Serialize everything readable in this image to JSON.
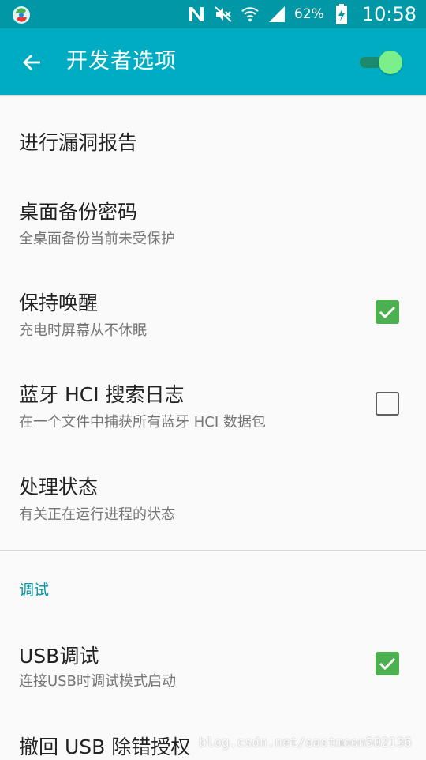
{
  "status_bar": {
    "battery_percent": "62%",
    "time": "10:58",
    "icons": [
      "app-notification-icon",
      "nfc-icon",
      "mute-icon",
      "wifi-icon",
      "cell-signal-icon",
      "battery-charging-icon"
    ]
  },
  "app_bar": {
    "title": "开发者选项",
    "master_switch_on": true,
    "accent_color": "#00acc1"
  },
  "items": [
    {
      "title": "进行漏洞报告",
      "summary": ""
    },
    {
      "title": "桌面备份密码",
      "summary": "全桌面备份当前未受保护"
    },
    {
      "title": "保持唤醒",
      "summary": "充电时屏幕从不休眠",
      "checked": true
    },
    {
      "title": "蓝牙 HCI 搜索日志",
      "summary": "在一个文件中捕获所有蓝牙 HCI 数据包",
      "checked": false
    },
    {
      "title": "处理状态",
      "summary": "有关正在运行进程的状态"
    }
  ],
  "debug_section": {
    "header": "调试",
    "items": [
      {
        "title": "USB调试",
        "summary": "连接USB时调试模式启动",
        "checked": true
      },
      {
        "title": "撤回 USB 除错授权",
        "summary": ""
      }
    ]
  },
  "watermark": "blog.csdn.net/eastmoon502136",
  "colors": {
    "status_bar": "#0097a7",
    "checkbox_checked": "#4caf50",
    "section_header": "#0097a7"
  }
}
